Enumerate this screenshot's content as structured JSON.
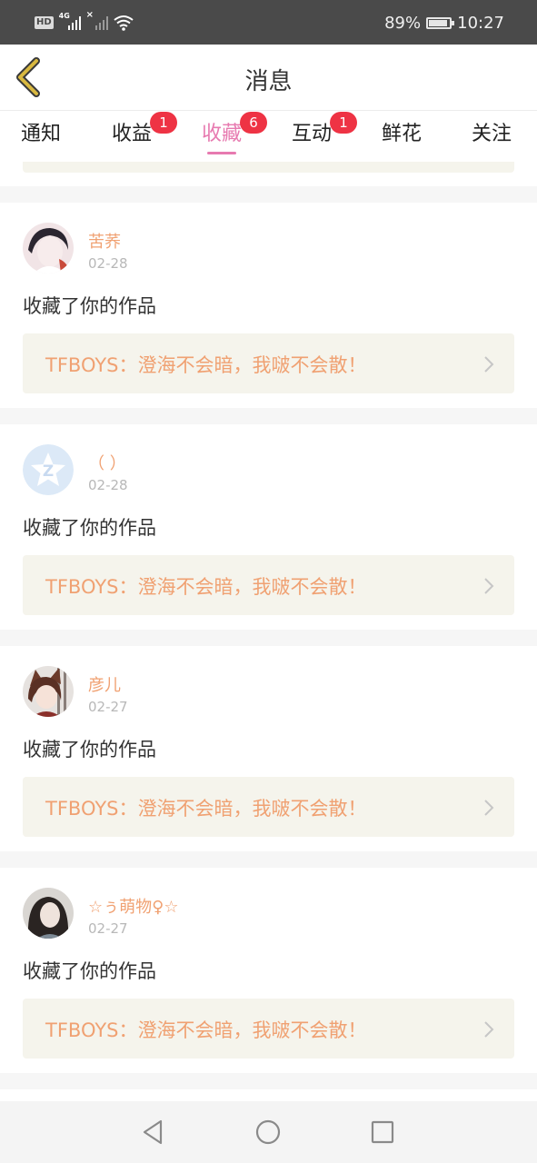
{
  "status_bar": {
    "hd_label": "HD",
    "network_label": "4G",
    "battery_percent_text": "89%",
    "battery_level": 0.89,
    "time": "10:27",
    "icons": [
      "hd-icon",
      "signal-4g-icon",
      "signal-no-sim-icon",
      "wifi-icon",
      "battery-icon"
    ]
  },
  "header": {
    "title": "消息",
    "back_icon": "chevron-left-icon",
    "back_icon_color": "#d8b840"
  },
  "tabs": [
    {
      "label": "通知",
      "badge": "",
      "active": false
    },
    {
      "label": "收益",
      "badge": "1",
      "active": false
    },
    {
      "label": "收藏",
      "badge": "6",
      "active": true
    },
    {
      "label": "互动",
      "badge": "1",
      "active": false
    },
    {
      "label": "鲜花",
      "badge": "",
      "active": false
    },
    {
      "label": "关注",
      "badge": "",
      "active": false
    }
  ],
  "colors": {
    "accent": "#e77ab0",
    "badge": "#ee3344",
    "username": "#f0a172",
    "link_bg": "#f5f4ec"
  },
  "messages": [
    {
      "username": "苦荞",
      "date": "02-28",
      "action": "收藏了你的作品",
      "work_title": "TFBOYS：澄海不会暗，我啵不会散！",
      "avatar": "girl-photo-avatar"
    },
    {
      "username": "（ ）",
      "date": "02-28",
      "action": "收藏了你的作品",
      "work_title": "TFBOYS：澄海不会暗，我啵不会散！",
      "avatar": "qq-zone-default-avatar"
    },
    {
      "username": "彦儿",
      "date": "02-27",
      "action": "收藏了你的作品",
      "work_title": "TFBOYS：澄海不会暗，我啵不会散！",
      "avatar": "anime-girl-avatar"
    },
    {
      "username": "☆ぅ萌物♀☆",
      "date": "02-27",
      "action": "收藏了你的作品",
      "work_title": "TFBOYS：澄海不会暗，我啵不会散！",
      "avatar": "girl-photo-avatar-2"
    }
  ],
  "nav_bar": {
    "buttons": [
      "back-triangle-icon",
      "home-circle-icon",
      "recents-square-icon"
    ]
  }
}
